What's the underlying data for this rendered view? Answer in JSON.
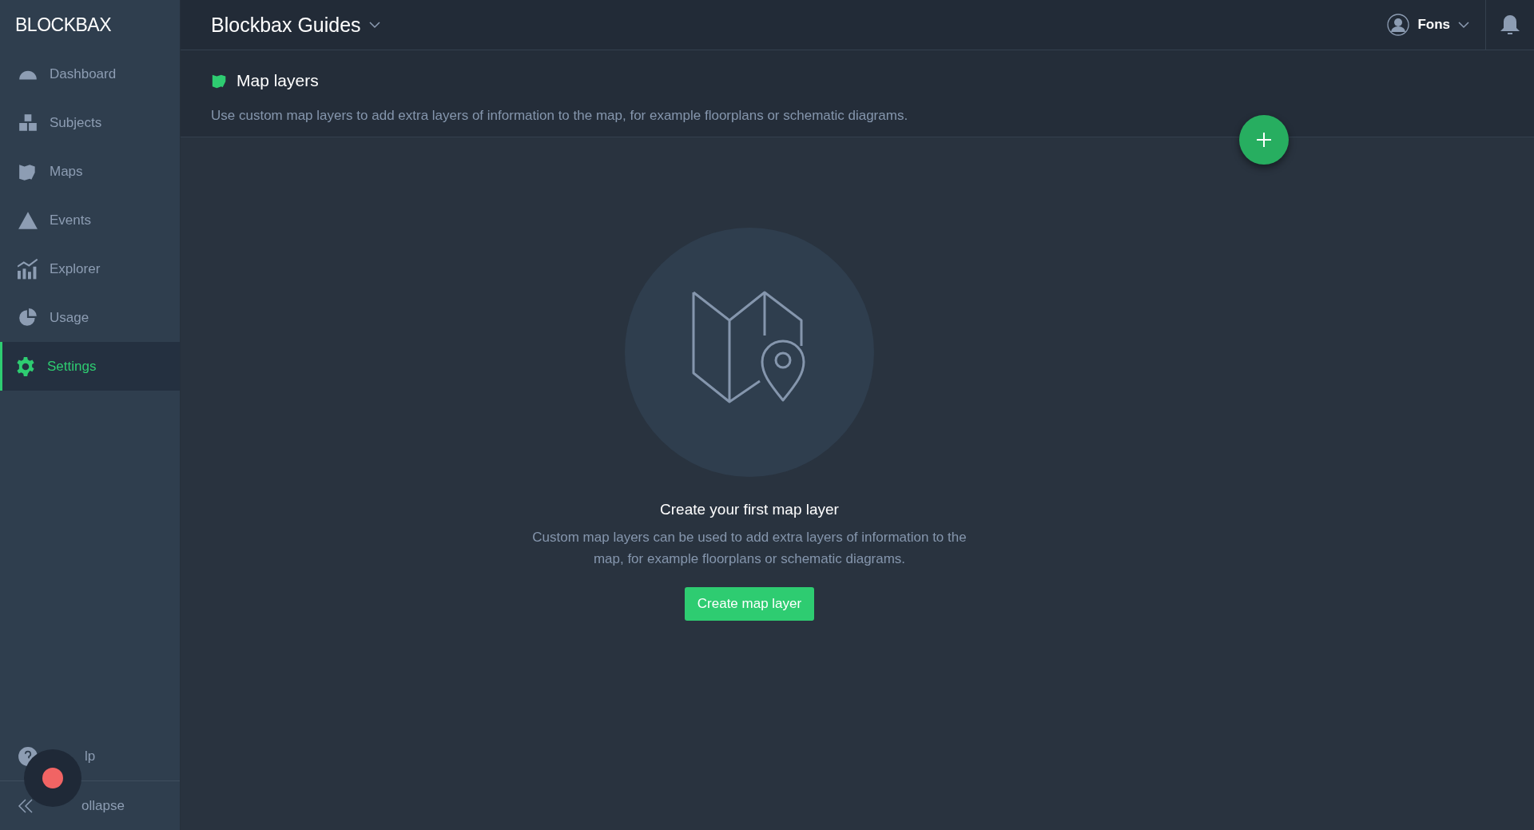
{
  "logo": "BLOCKBAX",
  "sidebar": {
    "items": [
      {
        "kind": "dashboard",
        "label": "Dashboard",
        "selected": false
      },
      {
        "kind": "subjects",
        "label": "Subjects",
        "selected": false
      },
      {
        "kind": "maps",
        "label": "Maps",
        "selected": false
      },
      {
        "kind": "events",
        "label": "Events",
        "selected": false
      },
      {
        "kind": "explorer",
        "label": "Explorer",
        "selected": false
      },
      {
        "kind": "usage",
        "label": "Usage",
        "selected": false
      },
      {
        "kind": "settings",
        "label": "Settings",
        "selected": true
      }
    ],
    "help": "lp",
    "collapse": "ollapse"
  },
  "header": {
    "project": "Blockbax Guides",
    "user": "Fons"
  },
  "section": {
    "title": "Map layers",
    "description": "Use custom map layers to add extra layers of information to the map, for example floorplans or schematic diagrams."
  },
  "empty_state": {
    "title": "Create your first map layer",
    "text": "Custom map layers can be used to add extra layers of information to the map, for example floorplans or schematic diagrams.",
    "button": "Create map layer"
  }
}
